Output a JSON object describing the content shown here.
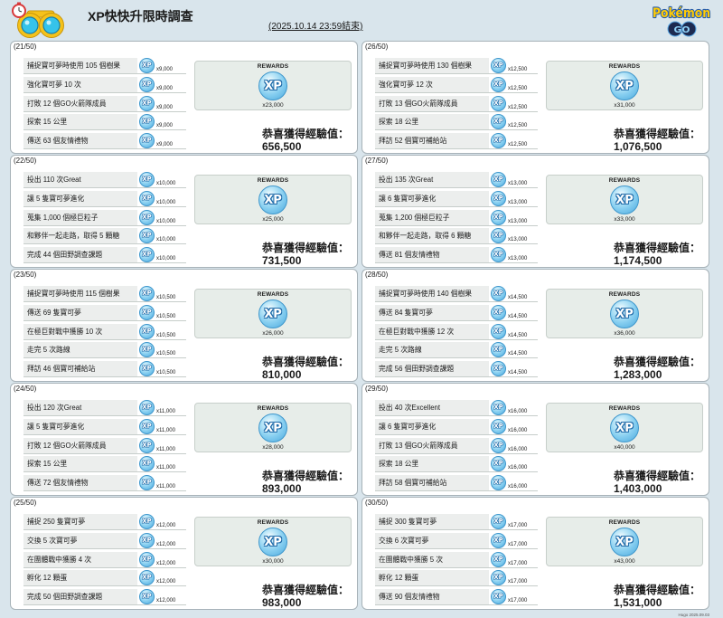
{
  "header": {
    "title": "XP快快升限時調查",
    "subtitle": "(2025.10.14 23:59結束)",
    "logo": {
      "brand": "Pokémon",
      "sub": "GO"
    }
  },
  "labels": {
    "rewards": "REWARDS",
    "congrats": "恭喜獲得經驗值：",
    "xp_icon": "XP"
  },
  "icons": {
    "header": [
      "stopwatch-icon",
      "goggles-icon"
    ],
    "task_reward": "xp-icon",
    "stage_reward": "xp-icon"
  },
  "colors": {
    "background": "#d9e5ec",
    "card": "#ffffff",
    "card_border": "#a7b2b8",
    "task_bar": "#eceeed",
    "row_line": "#c6cdca",
    "reward_box": "#e7ede9",
    "xp_blue": "#4aa8dc",
    "text": "#1a1a1a"
  },
  "stages": [
    {
      "stage": "(21/50)",
      "tasks": [
        {
          "task": "捕捉寶可夢時使用 105 個樹果",
          "reward": "x9,000"
        },
        {
          "task": "強化寶可夢 10 次",
          "reward": "x9,000"
        },
        {
          "task": "打敗 12 個GO火箭隊成員",
          "reward": "x9,000"
        },
        {
          "task": "探索 15 公里",
          "reward": "x9,000"
        },
        {
          "task": "傳送 63 個友情禮物",
          "reward": "x9,000"
        }
      ],
      "stage_reward": "x23,000",
      "total_xp": "656,500"
    },
    {
      "stage": "(22/50)",
      "tasks": [
        {
          "task": "投出 110 次Great",
          "reward": "x10,000"
        },
        {
          "task": "讓 5 隻寶可夢進化",
          "reward": "x10,000"
        },
        {
          "task": "蒐集 1,000 個極巨粒子",
          "reward": "x10,000"
        },
        {
          "task": "和夥伴一起走路，取得 5 顆糖",
          "reward": "x10,000"
        },
        {
          "task": "完成 44 個田野調查課題",
          "reward": "x10,000"
        }
      ],
      "stage_reward": "x25,000",
      "total_xp": "731,500"
    },
    {
      "stage": "(23/50)",
      "tasks": [
        {
          "task": "捕捉寶可夢時使用 115 個樹果",
          "reward": "x10,500"
        },
        {
          "task": "傳送 69 隻寶可夢",
          "reward": "x10,500"
        },
        {
          "task": "在極巨對戰中獲勝 10 次",
          "reward": "x10,500"
        },
        {
          "task": "走完 5 次路線",
          "reward": "x10,500"
        },
        {
          "task": "拜訪 46 個寶可補給站",
          "reward": "x10,500"
        }
      ],
      "stage_reward": "x26,000",
      "total_xp": "810,000"
    },
    {
      "stage": "(24/50)",
      "tasks": [
        {
          "task": "投出 120 次Great",
          "reward": "x11,000"
        },
        {
          "task": "讓 5 隻寶可夢進化",
          "reward": "x11,000"
        },
        {
          "task": "打敗 12 個GO火箭隊成員",
          "reward": "x11,000"
        },
        {
          "task": "探索 15 公里",
          "reward": "x11,000"
        },
        {
          "task": "傳送 72 個友情禮物",
          "reward": "x11,000"
        }
      ],
      "stage_reward": "x28,000",
      "total_xp": "893,000"
    },
    {
      "stage": "(25/50)",
      "tasks": [
        {
          "task": "捕捉 250 隻寶可夢",
          "reward": "x12,000"
        },
        {
          "task": "交換 5 次寶可夢",
          "reward": "x12,000"
        },
        {
          "task": "在團體戰中獲勝 4 次",
          "reward": "x12,000"
        },
        {
          "task": "孵化 12 顆蛋",
          "reward": "x12,000"
        },
        {
          "task": "完成 50 個田野調查課題",
          "reward": "x12,000"
        }
      ],
      "stage_reward": "x30,000",
      "total_xp": "983,000"
    },
    {
      "stage": "(26/50)",
      "tasks": [
        {
          "task": "捕捉寶可夢時使用 130 個樹果",
          "reward": "x12,500"
        },
        {
          "task": "強化寶可夢 12 次",
          "reward": "x12,500"
        },
        {
          "task": "打敗 13 個GO火箭隊成員",
          "reward": "x12,500"
        },
        {
          "task": "探索 18 公里",
          "reward": "x12,500"
        },
        {
          "task": "拜訪 52 個寶可補給站",
          "reward": "x12,500"
        }
      ],
      "stage_reward": "x31,000",
      "total_xp": "1,076,500"
    },
    {
      "stage": "(27/50)",
      "tasks": [
        {
          "task": "投出 135 次Great",
          "reward": "x13,000"
        },
        {
          "task": "讓 6 隻寶可夢進化",
          "reward": "x13,000"
        },
        {
          "task": "蒐集 1,200 個極巨粒子",
          "reward": "x13,000"
        },
        {
          "task": "和夥伴一起走路，取得 6 顆糖",
          "reward": "x13,000"
        },
        {
          "task": "傳送 81 個友情禮物",
          "reward": "x13,000"
        }
      ],
      "stage_reward": "x33,000",
      "total_xp": "1,174,500"
    },
    {
      "stage": "(28/50)",
      "tasks": [
        {
          "task": "捕捉寶可夢時使用 140 個樹果",
          "reward": "x14,500"
        },
        {
          "task": "傳送 84 隻寶可夢",
          "reward": "x14,500"
        },
        {
          "task": "在極巨對戰中獲勝 12 次",
          "reward": "x14,500"
        },
        {
          "task": "走完 5 次路線",
          "reward": "x14,500"
        },
        {
          "task": "完成 56 個田野調查課題",
          "reward": "x14,500"
        }
      ],
      "stage_reward": "x36,000",
      "total_xp": "1,283,000"
    },
    {
      "stage": "(29/50)",
      "tasks": [
        {
          "task": "投出 40 次Excellent",
          "reward": "x16,000"
        },
        {
          "task": "讓 6 隻寶可夢進化",
          "reward": "x16,000"
        },
        {
          "task": "打敗 13 個GO火箭隊成員",
          "reward": "x16,000"
        },
        {
          "task": "探索 18 公里",
          "reward": "x16,000"
        },
        {
          "task": "拜訪 58 個寶可補給站",
          "reward": "x16,000"
        }
      ],
      "stage_reward": "x40,000",
      "total_xp": "1,403,000"
    },
    {
      "stage": "(30/50)",
      "tasks": [
        {
          "task": "捕捉 300 隻寶可夢",
          "reward": "x17,000"
        },
        {
          "task": "交換 6 次寶可夢",
          "reward": "x17,000"
        },
        {
          "task": "在團體戰中獲勝 5 次",
          "reward": "x17,000"
        },
        {
          "task": "孵化 12 顆蛋",
          "reward": "x17,000"
        },
        {
          "task": "傳送 90 個友情禮物",
          "reward": "x17,000"
        }
      ],
      "stage_reward": "x43,000",
      "total_xp": "1,531,000"
    }
  ],
  "credit": "Hugo 2025.09.03"
}
